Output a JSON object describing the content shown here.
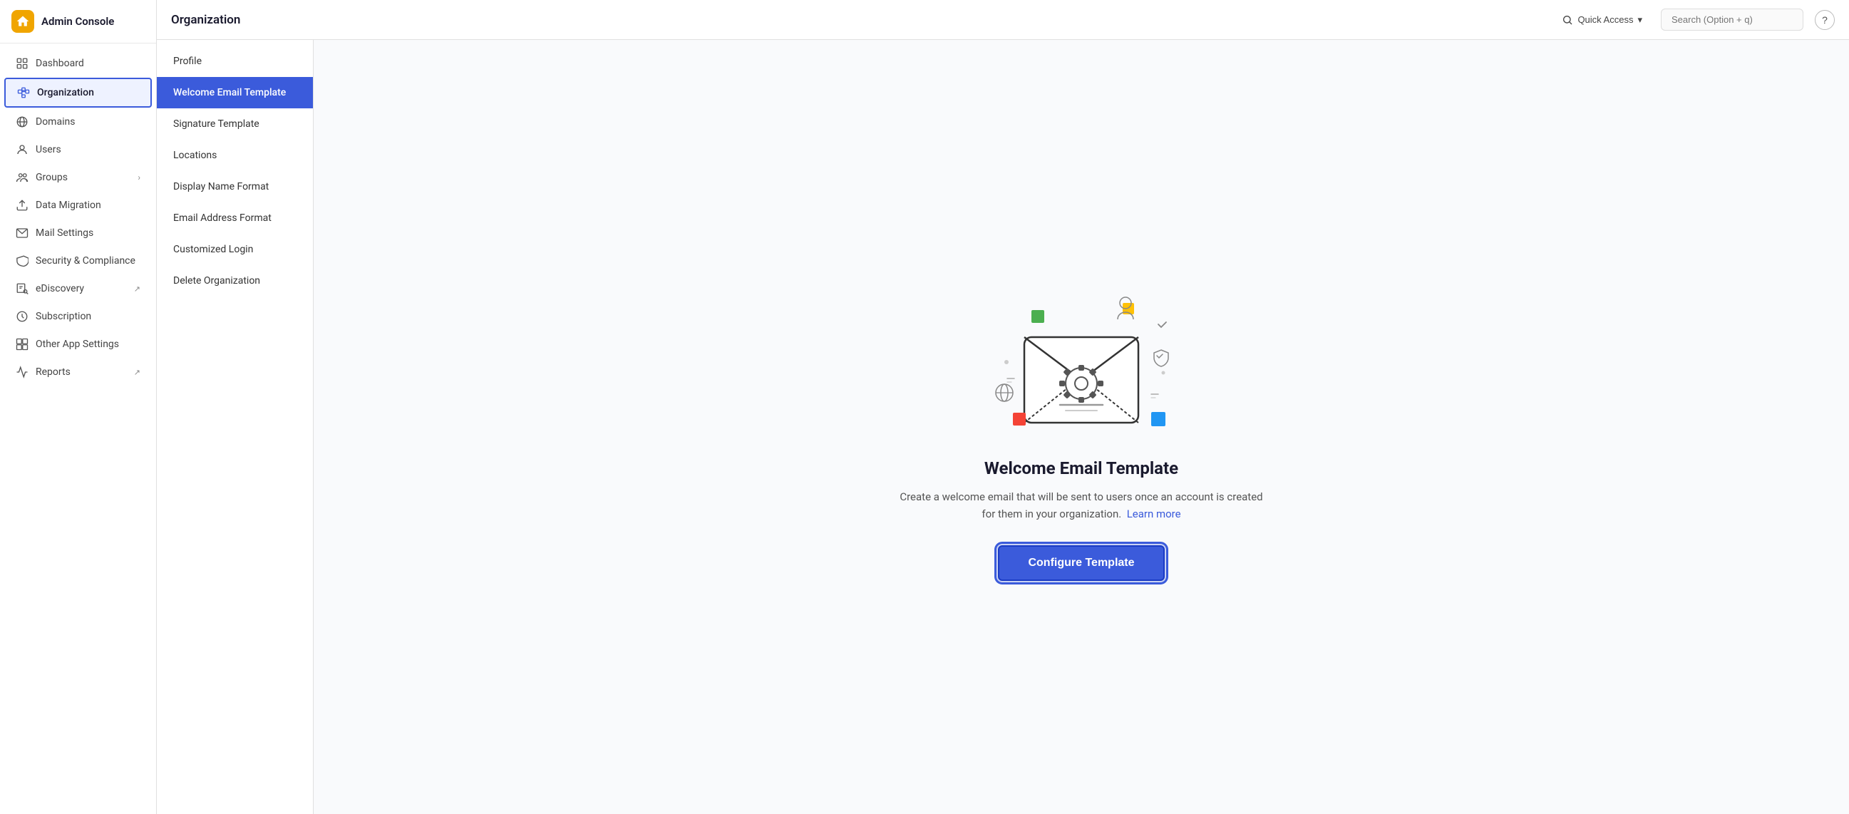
{
  "app": {
    "title": "Admin Console"
  },
  "topbar": {
    "title": "Organization",
    "quick_access": "Quick Access",
    "search_placeholder": "Search (Option + q)"
  },
  "sidebar": {
    "items": [
      {
        "id": "dashboard",
        "label": "Dashboard",
        "icon": "dashboard-icon"
      },
      {
        "id": "organization",
        "label": "Organization",
        "icon": "organization-icon",
        "active": true
      },
      {
        "id": "domains",
        "label": "Domains",
        "icon": "domains-icon"
      },
      {
        "id": "users",
        "label": "Users",
        "icon": "users-icon"
      },
      {
        "id": "groups",
        "label": "Groups",
        "icon": "groups-icon",
        "hasChevron": true
      },
      {
        "id": "data-migration",
        "label": "Data Migration",
        "icon": "migration-icon"
      },
      {
        "id": "mail-settings",
        "label": "Mail Settings",
        "icon": "mail-icon"
      },
      {
        "id": "security",
        "label": "Security & Compliance",
        "icon": "security-icon"
      },
      {
        "id": "ediscovery",
        "label": "eDiscovery",
        "icon": "ediscovery-icon",
        "hasExternal": true
      },
      {
        "id": "subscription",
        "label": "Subscription",
        "icon": "subscription-icon"
      },
      {
        "id": "other-app-settings",
        "label": "Other App Settings",
        "icon": "apps-icon"
      },
      {
        "id": "reports",
        "label": "Reports",
        "icon": "reports-icon",
        "hasExternal": true
      }
    ]
  },
  "submenu": {
    "items": [
      {
        "id": "profile",
        "label": "Profile",
        "active": false
      },
      {
        "id": "welcome-email",
        "label": "Welcome Email Template",
        "active": true
      },
      {
        "id": "signature-template",
        "label": "Signature Template",
        "active": false
      },
      {
        "id": "locations",
        "label": "Locations",
        "active": false
      },
      {
        "id": "display-name",
        "label": "Display Name Format",
        "active": false
      },
      {
        "id": "email-address",
        "label": "Email Address Format",
        "active": false
      },
      {
        "id": "customized-login",
        "label": "Customized Login",
        "active": false
      },
      {
        "id": "delete-org",
        "label": "Delete Organization",
        "active": false
      }
    ]
  },
  "page": {
    "heading": "Welcome Email Template",
    "description": "Create a welcome email that will be sent to users once an account is created for them in your organization.",
    "learn_more": "Learn more",
    "configure_button": "Configure Template"
  },
  "colors": {
    "primary": "#3b5bdb",
    "active_bg": "#3b5bdb",
    "active_text": "#ffffff"
  }
}
